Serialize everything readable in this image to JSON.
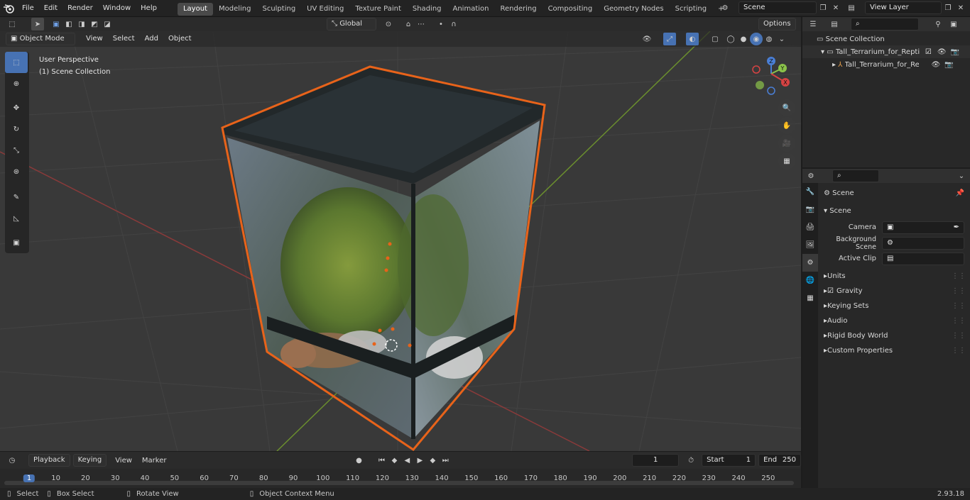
{
  "menus": [
    "File",
    "Edit",
    "Render",
    "Window",
    "Help"
  ],
  "workspaces": [
    "Layout",
    "Modeling",
    "Sculpting",
    "UV Editing",
    "Texture Paint",
    "Shading",
    "Animation",
    "Rendering",
    "Compositing",
    "Geometry Nodes",
    "Scripting"
  ],
  "top": {
    "scene": "Scene",
    "view_layer": "View Layer",
    "add_workspace": "+"
  },
  "viewport": {
    "mode": "Object Mode",
    "menus": [
      "View",
      "Select",
      "Add",
      "Object"
    ],
    "orientation": "Global",
    "options": "Options",
    "info_line1": "User Perspective",
    "info_line2": "(1) Scene Collection",
    "gizmo": {
      "x": "X",
      "y": "Y",
      "z": "Z"
    }
  },
  "outliner": {
    "root": "Scene Collection",
    "item1": "Tall_Terrarium_for_Reptiles_w",
    "item2": "Tall_Terrarium_for_Reptile"
  },
  "properties": {
    "header": "Scene",
    "panel": "Scene",
    "camera_label": "Camera",
    "background_label": "Background Scene",
    "clip_label": "Active Clip",
    "sections": [
      "Units",
      "Gravity",
      "Keying Sets",
      "Audio",
      "Rigid Body World",
      "Custom Properties"
    ]
  },
  "timeline": {
    "playback": "Playback",
    "keying": "Keying",
    "view": "View",
    "marker": "Marker",
    "current": "1",
    "start_label": "Start",
    "start": "1",
    "end_label": "End",
    "end": "250",
    "ticks": [
      "1",
      "10",
      "20",
      "30",
      "40",
      "50",
      "60",
      "70",
      "80",
      "90",
      "100",
      "110",
      "120",
      "130",
      "140",
      "150",
      "160",
      "170",
      "180",
      "190",
      "200",
      "210",
      "220",
      "230",
      "240",
      "250"
    ]
  },
  "status": {
    "select": "Select",
    "box_select": "Box Select",
    "rotate": "Rotate View",
    "context": "Object Context Menu",
    "version": "2.93.18"
  },
  "colors": {
    "accent": "#4772b3",
    "selection_outline": "#e8631a",
    "x_axis": "#d64343",
    "y_axis": "#8bc34a"
  }
}
